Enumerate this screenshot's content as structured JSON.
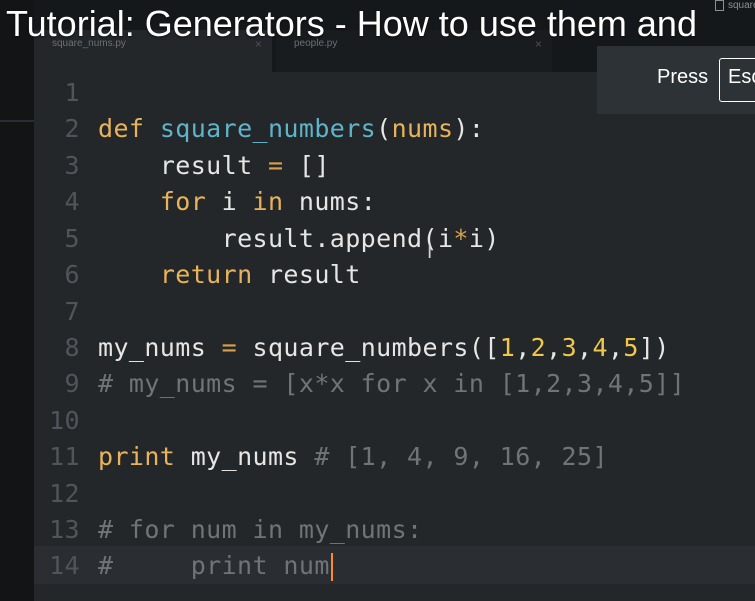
{
  "video": {
    "title": "Tutorial: Generators - How to use them and"
  },
  "overlay": {
    "press_label": "Press",
    "key_label": "Esc",
    "file_chip": "square"
  },
  "tabs": [
    {
      "label": "square_nums.py"
    },
    {
      "label": "people.py"
    }
  ],
  "editor": {
    "lines": [
      {
        "n": "1"
      },
      {
        "n": "2",
        "def": "def",
        "fname": "square_numbers",
        "open": "(",
        "param": "nums",
        "close": "):"
      },
      {
        "n": "3",
        "indent": "    ",
        "var": "result",
        "eq": " = ",
        "val": "[]"
      },
      {
        "n": "4",
        "indent": "    ",
        "for": "for",
        "mid": " i ",
        "in": "in",
        "rest": " nums:"
      },
      {
        "n": "5",
        "indent": "        ",
        "pre": "result.append(i",
        "star": "*",
        "post": "i)"
      },
      {
        "n": "6",
        "indent": "    ",
        "ret": "return",
        "rest": " result"
      },
      {
        "n": "7"
      },
      {
        "n": "8",
        "var": "my_nums",
        "eq": " = ",
        "call": "square_numbers([",
        "n1": "1",
        "n2": "2",
        "n3": "3",
        "n4": "4",
        "n5": "5",
        "end": "])"
      },
      {
        "n": "9",
        "comment": "# my_nums = [x*x for x in [1,2,3,4,5]]"
      },
      {
        "n": "10"
      },
      {
        "n": "11",
        "print": "print",
        "rest": " my_nums ",
        "comment": "# [1, 4, 9, 16, 25]"
      },
      {
        "n": "12"
      },
      {
        "n": "13",
        "comment": "# for num in my_nums:"
      },
      {
        "n": "14",
        "comment": "#     print num"
      }
    ]
  }
}
